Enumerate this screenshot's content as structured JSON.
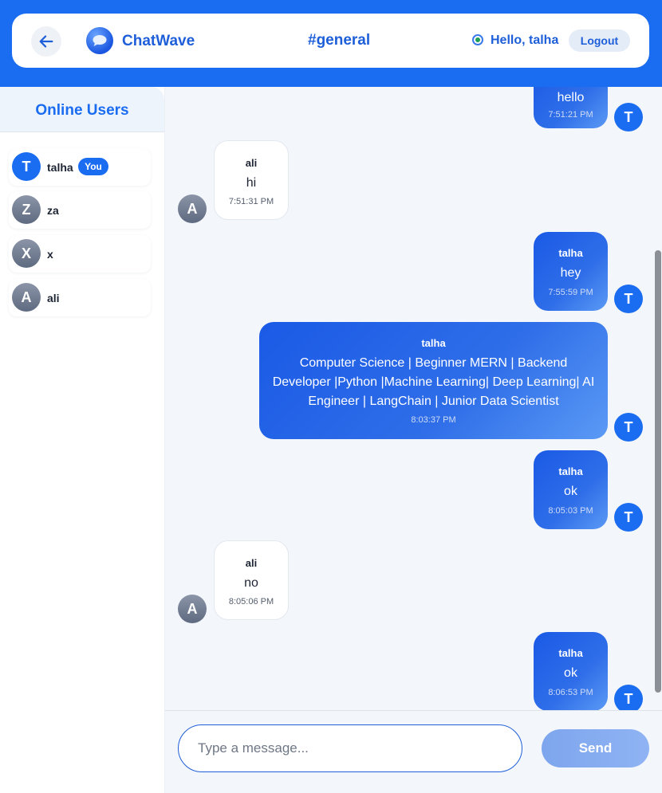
{
  "header": {
    "brand": "ChatWave",
    "channel": "#general",
    "greeting": "Hello, talha",
    "logout_label": "Logout"
  },
  "sidebar": {
    "title": "Online Users",
    "users": [
      {
        "initial": "T",
        "name": "talha",
        "badge": "You"
      },
      {
        "initial": "Z",
        "name": "za"
      },
      {
        "initial": "X",
        "name": "x"
      },
      {
        "initial": "A",
        "name": "ali"
      }
    ]
  },
  "messages": [
    {
      "sender": "",
      "initial": "T",
      "text": "hello",
      "time": "7:51:21 PM",
      "own": true
    },
    {
      "sender": "ali",
      "initial": "A",
      "text": "hi",
      "time": "7:51:31 PM",
      "own": false
    },
    {
      "sender": "talha",
      "initial": "T",
      "text": "hey",
      "time": "7:55:59 PM",
      "own": true
    },
    {
      "sender": "talha",
      "initial": "T",
      "text": "Computer Science | Beginner MERN | Backend Developer |Python |Machine Learning| Deep Learning| AI Engineer | LangChain | Junior Data Scientist",
      "time": "8:03:37 PM",
      "own": true
    },
    {
      "sender": "talha",
      "initial": "T",
      "text": "ok",
      "time": "8:05:03 PM",
      "own": true
    },
    {
      "sender": "ali",
      "initial": "A",
      "text": "no",
      "time": "8:05:06 PM",
      "own": false
    },
    {
      "sender": "talha",
      "initial": "T",
      "text": "ok",
      "time": "8:06:53 PM",
      "own": true
    }
  ],
  "composer": {
    "placeholder": "Type a message...",
    "value": "",
    "send_label": "Send"
  },
  "colors": {
    "accent": "#1a6cf0",
    "own_bubble": "#2563eb",
    "online": "#1e9e56"
  }
}
